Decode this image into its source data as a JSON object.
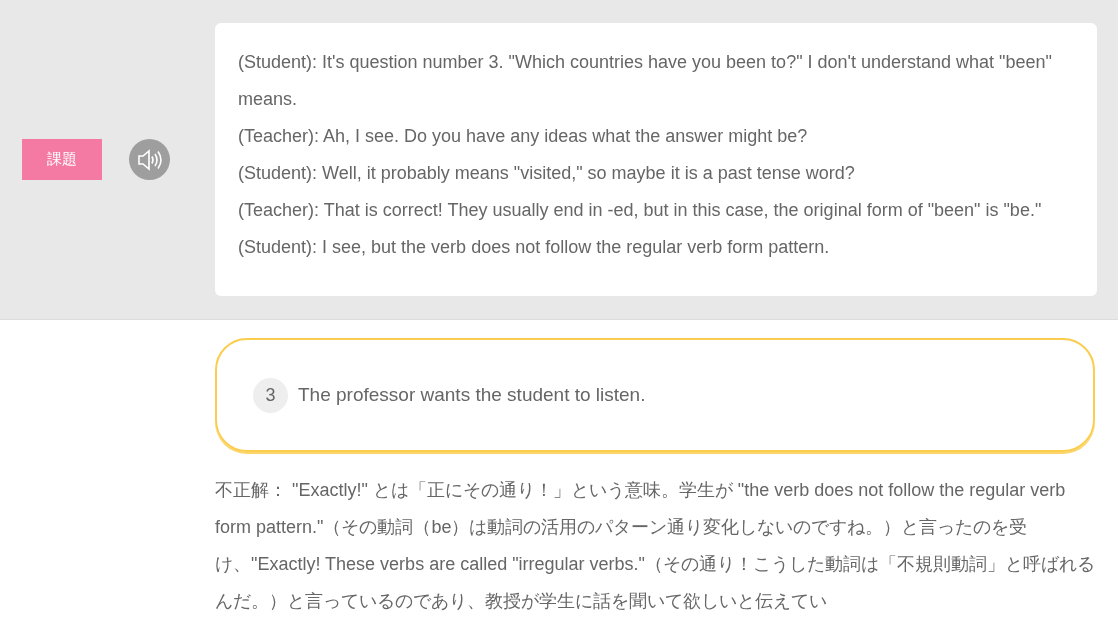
{
  "task_button": {
    "label": "課題"
  },
  "transcript": {
    "lines": [
      "(Student): It's question number 3. \"Which countries have you been to?\" I don't understand what \"been\" means.",
      "(Teacher): Ah, I see. Do you have any ideas what the answer might be?",
      "(Student): Well, it probably means \"visited,\" so maybe it is a past tense word?",
      "(Teacher): That is correct! They usually end in -ed, but in this case, the original form of \"been\" is \"be.\"",
      "(Student): I see, but the verb does not follow the regular verb form pattern."
    ]
  },
  "option": {
    "number": "3",
    "text": "The professor wants the student to listen.",
    "selected": true
  },
  "explanation": "不正解： \"Exactly!\" とは「正にその通り！」という意味。学生が \"the verb does not follow the regular verb form pattern.\"（その動詞（be）は動詞の活用のパターン通り変化しないのですね。）と言ったのを受け、\"Exactly! These verbs are called \"irregular verbs.\"（その通り！こうした動詞は「不規則動詞」と呼ばれるんだ。）と言っているのであり、教授が学生に話を聞いて欲しいと伝えてい"
}
